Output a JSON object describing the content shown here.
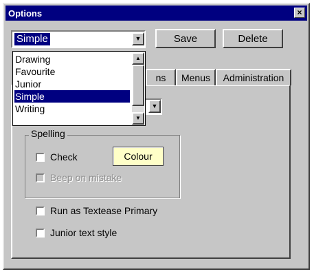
{
  "window": {
    "title": "Options",
    "close_label": "×"
  },
  "profile": {
    "selected": "Simple",
    "arrow": "▼"
  },
  "buttons": {
    "save": "Save",
    "delete": "Delete"
  },
  "tabs": [
    {
      "label": "ns"
    },
    {
      "label": "Menus"
    },
    {
      "label": "Administration"
    }
  ],
  "dropdown": {
    "items": [
      "Drawing",
      "Favourite",
      "Junior",
      "Simple",
      "Writing"
    ],
    "selected_index": 3,
    "scroll_up": "▲",
    "scroll_down": "▼"
  },
  "small_select": {
    "arrow": "▼"
  },
  "spelling": {
    "group_label": "Spelling",
    "check_label": "Check",
    "colour_label": "Colour",
    "beep_label": "Beep on mistake"
  },
  "options": {
    "run_as_label": "Run as Textease Primary",
    "junior_label": "Junior text style"
  },
  "colors": {
    "titlebar": "#000080",
    "face": "#c6c6c6",
    "highlight": "#000080",
    "colour_button": "#ffffc8"
  }
}
